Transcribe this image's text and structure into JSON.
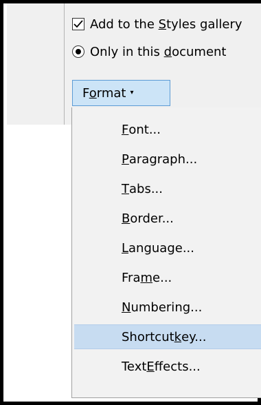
{
  "dialog": {
    "add_to_gallery": {
      "pre": "Add to the ",
      "key": "S",
      "post": "tyles gallery",
      "checked": true
    },
    "only_in_document": {
      "pre": "Only in this ",
      "key": "d",
      "post": "ocument",
      "selected": true
    },
    "format_button": {
      "pre": "F",
      "key": "o",
      "post": "rmat",
      "caret": "▾"
    }
  },
  "menu": {
    "items": [
      {
        "pre": "",
        "key": "F",
        "post": "ont...",
        "highlighted": false
      },
      {
        "pre": "",
        "key": "P",
        "post": "aragraph...",
        "highlighted": false
      },
      {
        "pre": "",
        "key": "T",
        "post": "abs...",
        "highlighted": false
      },
      {
        "pre": "",
        "key": "B",
        "post": "order...",
        "highlighted": false
      },
      {
        "pre": "",
        "key": "L",
        "post": "anguage...",
        "highlighted": false
      },
      {
        "pre": "Fra",
        "key": "m",
        "post": "e...",
        "highlighted": false
      },
      {
        "pre": "",
        "key": "N",
        "post": "umbering...",
        "highlighted": false
      },
      {
        "pre": "Shortcut ",
        "key": "k",
        "post": "ey...",
        "highlighted": true
      },
      {
        "pre": "Text ",
        "key": "E",
        "post": "ffects...",
        "highlighted": false
      }
    ]
  }
}
